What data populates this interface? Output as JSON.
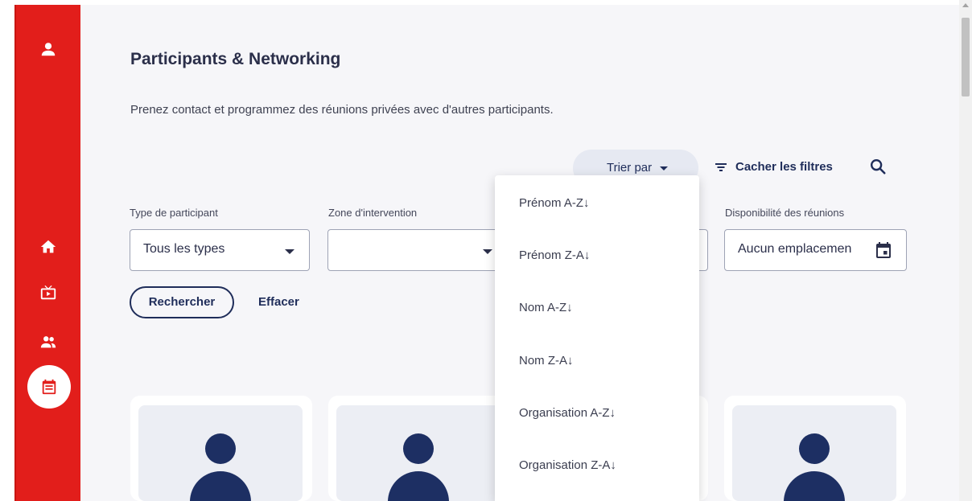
{
  "page": {
    "title": "Participants & Networking",
    "subtitle": "Prenez contact et programmez des réunions privées avec d'autres participants."
  },
  "toolbar": {
    "sort_label": "Trier par",
    "hide_filters_label": "Cacher les filtres"
  },
  "filters": {
    "type_label": "Type de participant",
    "type_value": "Tous les types",
    "zone_label": "Zone d'intervention",
    "zone_value": "",
    "availability_label": "Disponibilité des réunions",
    "availability_value": "Aucun emplacemen"
  },
  "actions": {
    "search_label": "Rechercher",
    "clear_label": "Effacer"
  },
  "sort_menu": {
    "items": [
      "Prénom A-Z↓",
      "Prénom Z-A↓",
      "Nom A-Z↓",
      "Nom Z-A↓",
      "Organisation A-Z↓",
      "Organisation Z-A↓"
    ]
  },
  "sidebar": {
    "icons": [
      "profile-icon",
      "home-icon",
      "live-tv-icon",
      "people-icon",
      "agenda-icon"
    ],
    "active": "agenda-icon"
  },
  "colors": {
    "sidebar": "#e21e1b",
    "primary": "#1f2d5a",
    "background": "#f6f6f9"
  }
}
